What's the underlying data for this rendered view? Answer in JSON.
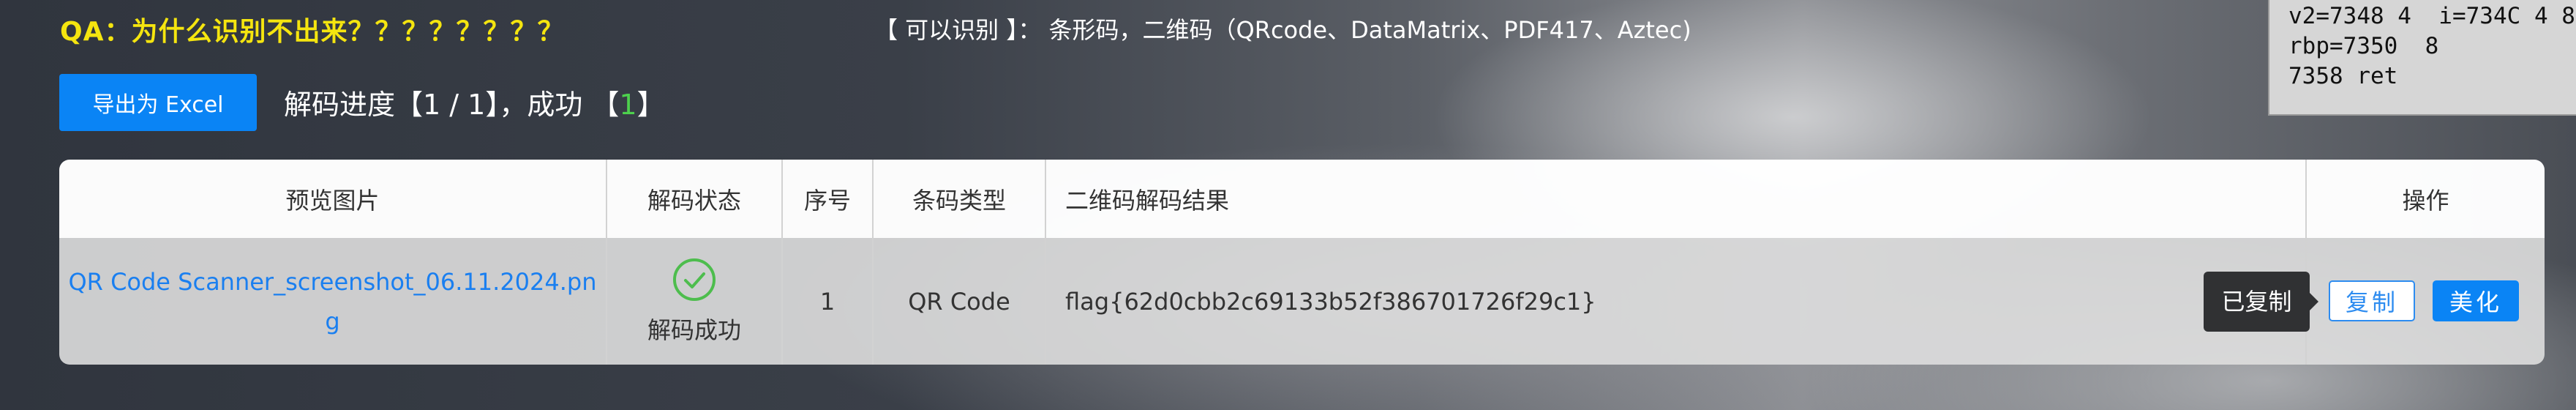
{
  "header": {
    "qa_title": "QA：为什么识别不出来？？？？？？？？",
    "supported_text": "【 可以识别 】： 条形码，二维码（QRcode、DataMatrix、PDF417、Aztec)"
  },
  "debug": {
    "lines": "v2=7348 4  i=734C 4 8\nrbp=7350  8\n7358 ret"
  },
  "toolbar": {
    "export_label": "导出为 Excel",
    "progress_prefix": "解码进度【1 / 1】，成功 【",
    "progress_success": "1",
    "progress_suffix": "】"
  },
  "table": {
    "headers": {
      "preview": "预览图片",
      "status": "解码状态",
      "index": "序号",
      "type": "条码类型",
      "result": "二维码解码结果",
      "action": "操作"
    },
    "rows": [
      {
        "preview": "QR Code Scanner_screenshot_06.11.2024.png",
        "status": "解码成功",
        "index": "1",
        "type": "QR Code",
        "result": "flag{62d0cbb2c69133b52f386701726f29c1}",
        "tooltip": "已复制",
        "copy_label": "复制",
        "beautify_label": "美化"
      }
    ]
  },
  "colors": {
    "accent": "#0a84f5",
    "title_yellow": "#f5e50f",
    "success_green": "#4dbd4d"
  }
}
